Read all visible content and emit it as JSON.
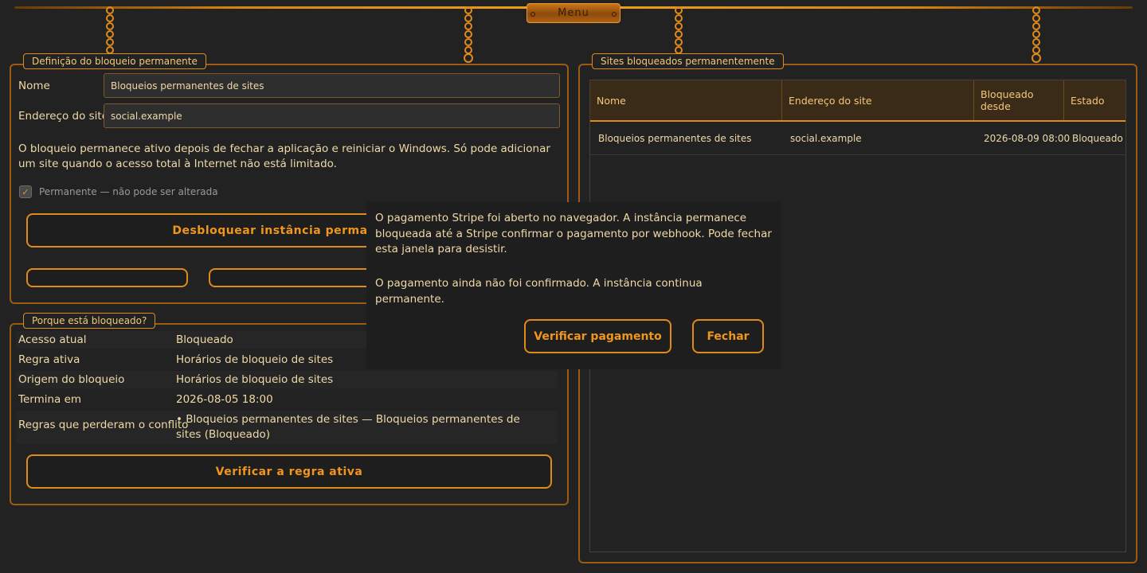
{
  "menu": {
    "label": "Menu"
  },
  "definition": {
    "legend": "Definição do bloqueio permanente",
    "name_label": "Nome",
    "name_value": "Bloqueios permanentes de sites",
    "site_label": "Endereço do site",
    "site_value": "social.example",
    "info": "O bloqueio permanece ativo depois de fechar a aplicação e reiniciar o Windows. Só pode adicionar um site quando o acesso total à Internet não está limitado.",
    "permanent_label": "Permanente — não pode ser alterada",
    "unlock_button": "Desbloquear instância permanente"
  },
  "why": {
    "legend": "Porque está bloqueado?",
    "rows": [
      {
        "key": "Acesso atual",
        "value": "Bloqueado"
      },
      {
        "key": "Regra ativa",
        "value": "Horários de bloqueio de sites"
      },
      {
        "key": "Origem do bloqueio",
        "value": "Horários de bloqueio de sites"
      },
      {
        "key": "Termina em",
        "value": "2026-08-05 18:00"
      },
      {
        "key": "Regras que perderam o conflito",
        "value": "• Bloqueios permanentes de sites — Bloqueios permanentes de sites (Bloqueado)"
      }
    ],
    "check_button": "Verificar a regra ativa"
  },
  "sites": {
    "legend": "Sites bloqueados permanentemente",
    "columns": [
      "Nome",
      "Endereço do site",
      "Bloqueado desde",
      "Estado"
    ],
    "rows": [
      [
        "Bloqueios permanentes de sites",
        "social.example",
        "2026-08-09 08:00",
        "Bloqueado"
      ]
    ]
  },
  "dialog": {
    "message": "O pagamento Stripe foi aberto no navegador. A instância permanece bloqueada até a Stripe confirmar o pagamento por webhook. Pode fechar esta janela para desistir.",
    "status": "O pagamento ainda não foi confirmado. A instância continua permanente.",
    "verify_button": "Verificar pagamento",
    "close_button": "Fechar"
  },
  "colors": {
    "accent": "#e08a1a",
    "background": "#222222",
    "text": "#f0d9a8"
  }
}
